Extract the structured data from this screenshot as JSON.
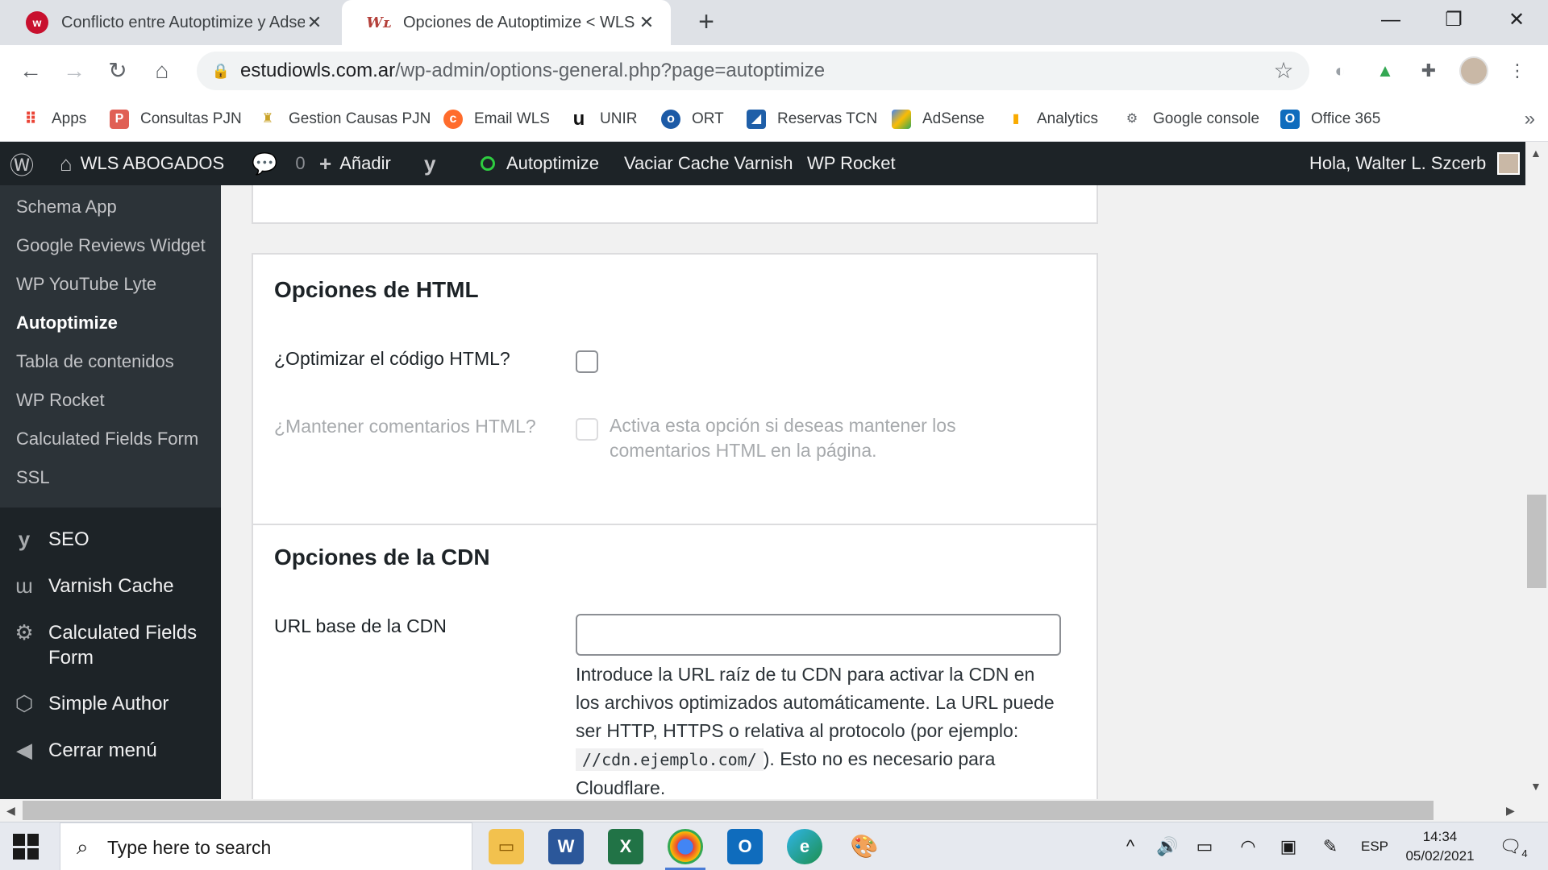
{
  "browser": {
    "tabs": [
      {
        "title": "Conflicto entre Autoptimize y Adsen",
        "active": false,
        "favicon": "web-red-circle-icon"
      },
      {
        "title": "Opciones de Autoptimize < WLS AB",
        "active": true,
        "favicon": "wls-logo-icon"
      }
    ],
    "url_host": "estudiowls.com.ar",
    "url_path": "/wp-admin/options-general.php?page=autoptimize",
    "bookmarks": [
      {
        "label": "Apps",
        "icon": "apps-grid-icon",
        "color": "#ea4335"
      },
      {
        "label": "Consultas PJN",
        "icon": "pjn-icon",
        "color": "#e06055"
      },
      {
        "label": "Gestion Causas PJN",
        "icon": "shield-crest-icon",
        "color": "#c9a227"
      },
      {
        "label": "Email WLS",
        "icon": "cpanel-icon",
        "color": "#ff6c2c"
      },
      {
        "label": "UNIR",
        "icon": "unir-icon",
        "color": "#111111"
      },
      {
        "label": "ORT",
        "icon": "ort-icon",
        "color": "#1c5aa6"
      },
      {
        "label": "Reservas TCN",
        "icon": "tcn-icon",
        "color": "#1f5fa8"
      },
      {
        "label": "AdSense",
        "icon": "adsense-icon",
        "color": "#fbbc04"
      },
      {
        "label": "Analytics",
        "icon": "analytics-icon",
        "color": "#f9ab00"
      },
      {
        "label": "Google console",
        "icon": "search-console-icon",
        "color": "#5f6368"
      },
      {
        "label": "Office 365",
        "icon": "outlook-icon",
        "color": "#0f6cbd"
      }
    ]
  },
  "adminbar": {
    "site_name": "WLS ABOGADOS",
    "comments_count": "0",
    "add_label": "Añadir",
    "autoptimize_label": "Autoptimize",
    "varnish_label": "Vaciar Cache Varnish",
    "rocket_label": "WP Rocket",
    "greeting": "Hola, Walter L. Szcerb"
  },
  "sidebar": {
    "submenu": [
      {
        "label": "Schema App",
        "current": false
      },
      {
        "label": "Google Reviews Widget",
        "current": false
      },
      {
        "label": "WP YouTube Lyte",
        "current": false
      },
      {
        "label": "Autoptimize",
        "current": true
      },
      {
        "label": "Tabla de contenidos",
        "current": false
      },
      {
        "label": "WP Rocket",
        "current": false
      },
      {
        "label": "Calculated Fields Form",
        "current": false
      },
      {
        "label": "SSL",
        "current": false
      }
    ],
    "menu": [
      {
        "label": "SEO",
        "icon": "yoast-icon"
      },
      {
        "label": "Varnish Cache",
        "icon": "varnish-icon"
      },
      {
        "label": "Calculated Fields Form",
        "icon": "gear-icon"
      },
      {
        "label": "Simple Author",
        "icon": "stack-icon"
      },
      {
        "label": "Cerrar menú",
        "icon": "collapse-arrow-icon"
      }
    ]
  },
  "html_panel": {
    "title": "Opciones de HTML",
    "optimize_label": "¿Optimizar el código HTML?",
    "optimize_checked": false,
    "keep_comments_label": "¿Mantener comentarios HTML?",
    "keep_comments_checked": false,
    "keep_comments_desc": "Activa esta opción si deseas mantener los comentarios HTML en la página."
  },
  "cdn_panel": {
    "title": "Opciones de la CDN",
    "url_label": "URL base de la CDN",
    "url_value": "",
    "desc_part1": "Introduce la URL raíz de tu CDN para activar la CDN en los archivos optimizados automáticamente. La URL puede ser HTTP, HTTPS o relativa al protocolo (por ejemplo:",
    "desc_code": "//cdn.ejemplo.com/",
    "desc_part2": "). Esto no es necesario para Cloudflare."
  },
  "taskbar": {
    "search_placeholder": "Type here to search",
    "apps": [
      "file-explorer-icon",
      "word-icon",
      "excel-icon",
      "chrome-icon",
      "outlook-icon",
      "edge-icon",
      "paint-icon"
    ],
    "language": "ESP",
    "time": "14:34",
    "date": "05/02/2021",
    "notifications": "4"
  }
}
